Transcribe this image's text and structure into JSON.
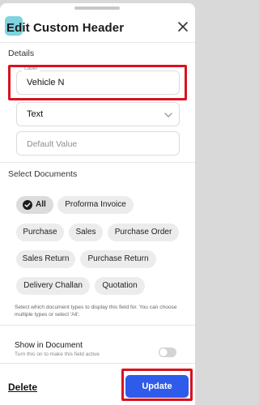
{
  "header": {
    "title": "Edit Custom Header",
    "close_icon": "close-icon",
    "app_badge_color": "#7fd3de"
  },
  "details": {
    "section_title": "Details",
    "label_field": {
      "floating_label": "Label",
      "value": "Vehicle N"
    },
    "type_field": {
      "value": "Text",
      "icon": "chevron-down-icon"
    },
    "default_field": {
      "placeholder": "Default Value"
    }
  },
  "documents": {
    "section_title": "Select Documents",
    "chips": [
      {
        "label": "All",
        "selected": true
      },
      {
        "label": "Proforma Invoice",
        "selected": false
      },
      {
        "label": "Purchase",
        "selected": false
      },
      {
        "label": "Sales",
        "selected": false
      },
      {
        "label": "Purchase Order",
        "selected": false
      },
      {
        "label": "Sales Return",
        "selected": false
      },
      {
        "label": "Purchase Return",
        "selected": false
      },
      {
        "label": "Delivery Challan",
        "selected": false
      },
      {
        "label": "Quotation",
        "selected": false
      }
    ],
    "helper_text": "Select which document types to display this field for. You can choose multiple types or select 'All'."
  },
  "show_in_document": {
    "title": "Show in Document",
    "subtitle": "Turn this on to make this field active",
    "enabled": false
  },
  "footer": {
    "delete_label": "Delete",
    "update_label": "Update"
  },
  "colors": {
    "accent": "#2f5bea",
    "highlight": "#d9121e"
  }
}
